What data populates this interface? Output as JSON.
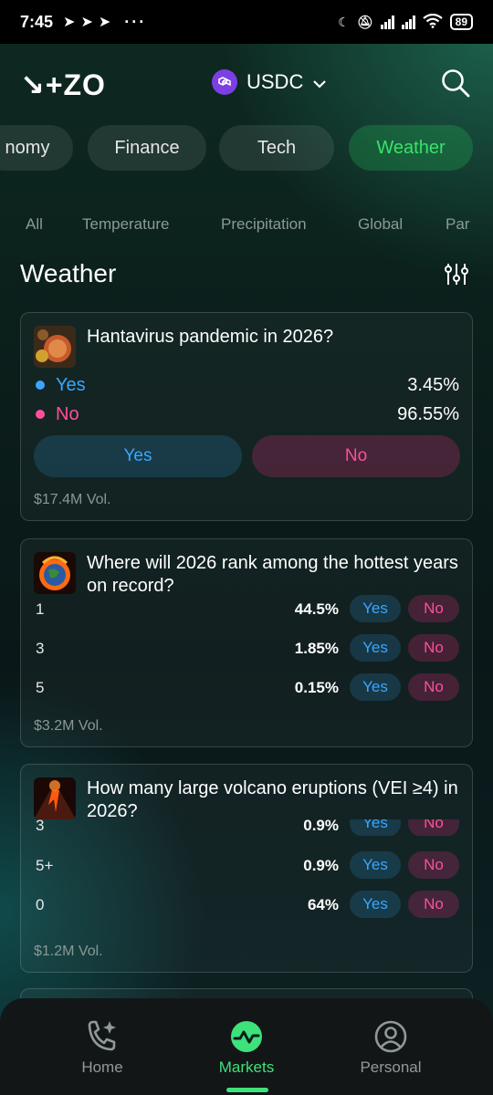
{
  "status_bar": {
    "time": "7:45",
    "dots": "···",
    "battery": "89"
  },
  "header": {
    "logo": "↘+ZO",
    "currency": "USDC"
  },
  "categories": [
    {
      "label": "nomy"
    },
    {
      "label": "Finance"
    },
    {
      "label": "Tech"
    },
    {
      "label": "Weather",
      "active": true
    }
  ],
  "subcategories": [
    "All",
    "Temperature",
    "Precipitation",
    "Global",
    "Par"
  ],
  "section_title": "Weather",
  "markets": [
    {
      "title": "Hantavirus pandemic in 2026?",
      "yes_label": "Yes",
      "no_label": "No",
      "yes_pct": "3.45%",
      "no_pct": "96.55%",
      "button_yes": "Yes",
      "button_no": "No",
      "volume": "$17.4M Vol."
    },
    {
      "title": "Where will 2026 rank among the hottest years on record?",
      "outcomes": [
        {
          "label": "1",
          "pct": "44.5%",
          "yes": "Yes",
          "no": "No"
        },
        {
          "label": "3",
          "pct": "1.85%",
          "yes": "Yes",
          "no": "No"
        },
        {
          "label": "5",
          "pct": "0.15%",
          "yes": "Yes",
          "no": "No"
        }
      ],
      "volume": "$3.2M Vol."
    },
    {
      "title": "How many large volcano eruptions (VEI ≥4) in 2026?",
      "outcomes": [
        {
          "label": "3",
          "pct": "0.9%",
          "yes": "Yes",
          "no": "No"
        },
        {
          "label": "5+",
          "pct": "0.9%",
          "yes": "Yes",
          "no": "No"
        },
        {
          "label": "0",
          "pct": "64%",
          "yes": "Yes",
          "no": "No"
        }
      ],
      "volume": "$1.2M Vol."
    }
  ],
  "nav": [
    {
      "label": "Home"
    },
    {
      "label": "Markets",
      "active": true
    },
    {
      "label": "Personal"
    }
  ],
  "colors": {
    "accent_green": "#3ee27a",
    "yes_blue": "#3aa6ff",
    "no_pink": "#ff4f9a"
  }
}
